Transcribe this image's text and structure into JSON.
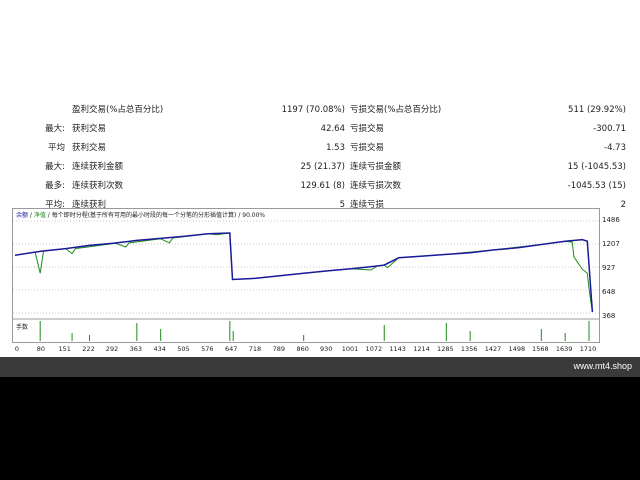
{
  "stats": [
    {
      "label1": "",
      "label2": "盈利交易(%占总百分比)",
      "value1": "1197 (70.08%)",
      "label3": "亏损交易(%占总百分比)",
      "value2": "511 (29.92%)"
    },
    {
      "label1": "最大:",
      "label2": "获利交易",
      "value1": "42.64",
      "label3": "亏损交易",
      "value2": "-300.71"
    },
    {
      "label1": "平均",
      "label2": "获利交易",
      "value1": "1.53",
      "label3": "亏损交易",
      "value2": "-4.73"
    },
    {
      "label1": "最大:",
      "label2": "连续获利金额",
      "value1": "25 (21.37)",
      "label3": "连续亏损金额",
      "value2": "15 (-1045.53)"
    },
    {
      "label1": "最多:",
      "label2": "连续获利次数",
      "value1": "129.61 (8)",
      "label3": "连续亏损次数",
      "value2": "-1045.53 (15)"
    },
    {
      "label1": "平均:",
      "label2": "连续获利",
      "value1": "5",
      "label3": "连续亏损",
      "value2": "2"
    }
  ],
  "chart": {
    "legend_balance": "余额",
    "legend_sep1": " / ",
    "legend_equity": "净值",
    "legend_sep2": " / ",
    "legend_text": "每个即时分程(基于所有可用的最小时段的每一个分笔的分形插值计算)",
    "legend_sep3": " / ",
    "legend_quality": "90.00%",
    "volume_label": "手数",
    "y_ticks": [
      "1486",
      "1207",
      "927",
      "648",
      "368"
    ],
    "x_ticks": [
      "0",
      "80",
      "151",
      "222",
      "292",
      "363",
      "434",
      "505",
      "576",
      "647",
      "718",
      "789",
      "860",
      "930",
      "1001",
      "1072",
      "1143",
      "1214",
      "1285",
      "1356",
      "1427",
      "1498",
      "1568",
      "1639",
      "1710"
    ],
    "colors": {
      "balance": "#1a1a9a",
      "equity": "#1d8a1d",
      "volume": "#1d8a1d",
      "grid": "#c8c8c8"
    }
  },
  "chart_data": {
    "type": "line",
    "x_range": [
      0,
      1710
    ],
    "ylim": [
      368,
      1486
    ],
    "series": [
      {
        "name": "余额",
        "points": [
          [
            0,
            1070
          ],
          [
            80,
            1120
          ],
          [
            151,
            1150
          ],
          [
            222,
            1190
          ],
          [
            292,
            1215
          ],
          [
            363,
            1250
          ],
          [
            434,
            1275
          ],
          [
            505,
            1300
          ],
          [
            576,
            1330
          ],
          [
            640,
            1340
          ],
          [
            648,
            775
          ],
          [
            718,
            790
          ],
          [
            789,
            820
          ],
          [
            860,
            850
          ],
          [
            930,
            880
          ],
          [
            1001,
            905
          ],
          [
            1072,
            935
          ],
          [
            1100,
            950
          ],
          [
            1143,
            1040
          ],
          [
            1214,
            1060
          ],
          [
            1285,
            1080
          ],
          [
            1356,
            1100
          ],
          [
            1427,
            1135
          ],
          [
            1498,
            1160
          ],
          [
            1568,
            1200
          ],
          [
            1639,
            1240
          ],
          [
            1690,
            1260
          ],
          [
            1705,
            1240
          ],
          [
            1720,
            380
          ]
        ]
      },
      {
        "name": "净值",
        "points": [
          [
            0,
            1070
          ],
          [
            60,
            1110
          ],
          [
            75,
            850
          ],
          [
            85,
            1120
          ],
          [
            151,
            1150
          ],
          [
            170,
            1090
          ],
          [
            180,
            1150
          ],
          [
            300,
            1215
          ],
          [
            330,
            1170
          ],
          [
            340,
            1220
          ],
          [
            434,
            1270
          ],
          [
            460,
            1220
          ],
          [
            470,
            1280
          ],
          [
            576,
            1330
          ],
          [
            600,
            1320
          ],
          [
            640,
            1340
          ],
          [
            648,
            775
          ],
          [
            718,
            790
          ],
          [
            860,
            850
          ],
          [
            1001,
            905
          ],
          [
            1060,
            890
          ],
          [
            1080,
            940
          ],
          [
            1100,
            950
          ],
          [
            1110,
            920
          ],
          [
            1143,
            1040
          ],
          [
            1285,
            1080
          ],
          [
            1427,
            1135
          ],
          [
            1568,
            1200
          ],
          [
            1639,
            1240
          ],
          [
            1660,
            1230
          ],
          [
            1665,
            1050
          ],
          [
            1690,
            900
          ],
          [
            1705,
            850
          ],
          [
            1712,
            600
          ],
          [
            1720,
            380
          ]
        ]
      }
    ],
    "volume_spikes": [
      [
        75,
        1
      ],
      [
        170,
        0.4
      ],
      [
        222,
        0.3
      ],
      [
        363,
        0.9
      ],
      [
        434,
        0.6
      ],
      [
        640,
        1
      ],
      [
        650,
        0.5
      ],
      [
        860,
        0.3
      ],
      [
        1100,
        0.8
      ],
      [
        1285,
        0.9
      ],
      [
        1356,
        0.5
      ],
      [
        1568,
        0.6
      ],
      [
        1639,
        0.4
      ],
      [
        1710,
        1
      ]
    ]
  },
  "footer": {
    "watermark": "www.mt4.shop"
  }
}
